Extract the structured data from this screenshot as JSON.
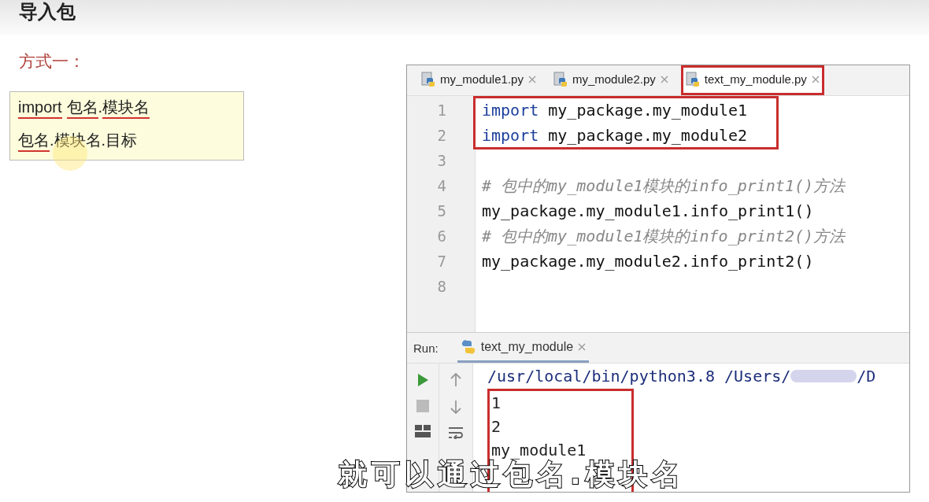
{
  "slide": {
    "title": "导入包",
    "method_label": "方式一：",
    "syntax_box": [
      [
        {
          "text": "import",
          "underlined": true
        },
        {
          "text": "包名",
          "underlined": true,
          "space_before": true
        },
        {
          "text": ".",
          "underlined": false
        },
        {
          "text": "模块名",
          "underlined": true
        }
      ],
      [
        {
          "text": "包名",
          "underlined": true
        },
        {
          "text": ".模块名.目标",
          "underlined": false
        }
      ]
    ]
  },
  "ide": {
    "tabs": [
      {
        "label": "my_module1.py",
        "selected": false,
        "boxed": false
      },
      {
        "label": "my_module2.py",
        "selected": false,
        "boxed": false
      },
      {
        "label": "text_my_module.py",
        "selected": true,
        "boxed": true
      }
    ],
    "editor_blocks": [
      {
        "boxed": true,
        "lines": [
          {
            "number": "1",
            "kind": "import",
            "keyword": "import",
            "text": "my_package.my_module1"
          },
          {
            "number": "2",
            "kind": "import",
            "keyword": "import",
            "text": "my_package.my_module2"
          }
        ]
      },
      {
        "lines": [
          {
            "number": "3",
            "kind": "blank"
          },
          {
            "number": "4",
            "kind": "comment",
            "text": "# 包中的my_module1模块的info_print1()方法"
          },
          {
            "number": "5",
            "kind": "code",
            "text": "my_package.my_module1.info_print1()"
          },
          {
            "number": "6",
            "kind": "comment",
            "text": "# 包中的my_module1模块的info_print2()方法"
          },
          {
            "number": "7",
            "kind": "code",
            "text": "my_package.my_module2.info_print2()"
          },
          {
            "number": "8",
            "kind": "blank"
          }
        ]
      }
    ],
    "run": {
      "label": "Run:",
      "tab": "text_my_module",
      "command": "/usr/local/bin/python3.8 /Users/",
      "command_tail": "/D",
      "output_blocks": [
        {
          "boxed": true,
          "lines": [
            "1",
            "2",
            "my_module1"
          ]
        }
      ]
    }
  },
  "subtitle": "就可以通过包名.模块名"
}
